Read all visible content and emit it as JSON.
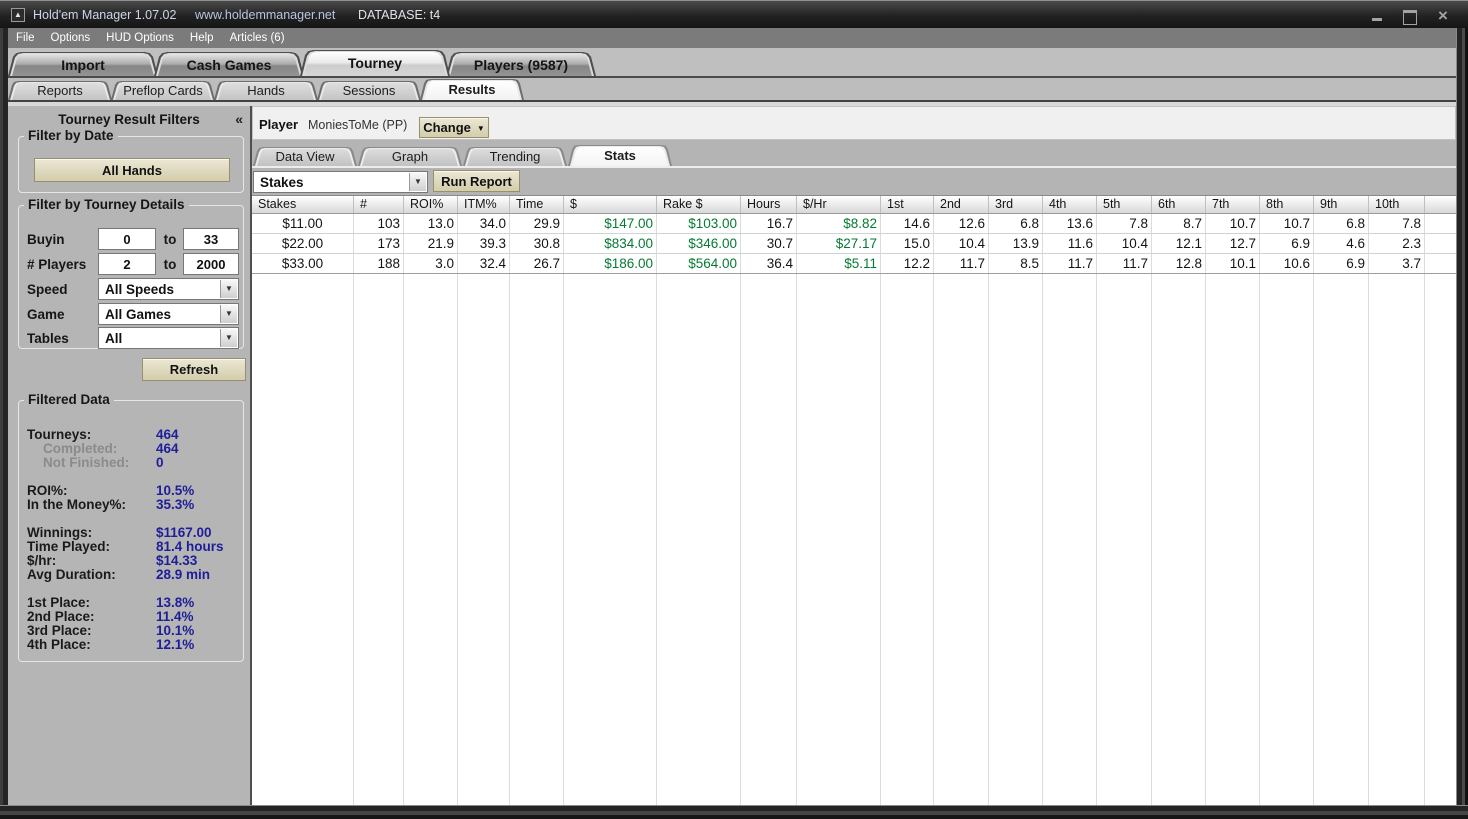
{
  "titlebar": {
    "title": "Hold'em Manager 1.07.02",
    "url": "www.holdemmanager.net",
    "database": "DATABASE: t4"
  },
  "menu": {
    "items": [
      "File",
      "Options",
      "HUD Options",
      "Help",
      "Articles (6)"
    ]
  },
  "main_tabs": {
    "items": [
      "Import",
      "Cash Games",
      "Tourney",
      "Players (9587)"
    ],
    "active": "Tourney"
  },
  "sub_tabs": {
    "items": [
      "Reports",
      "Preflop Cards",
      "Hands",
      "Sessions",
      "Results"
    ],
    "active": "Results"
  },
  "sidebar": {
    "title": "Tourney Result Filters",
    "collapse_icon": "«",
    "date_group": {
      "legend": "Filter by Date",
      "all_hands_button": "All Hands"
    },
    "details_group": {
      "legend": "Filter by Tourney Details",
      "buyin": {
        "label": "Buyin",
        "from": "0",
        "to_word": "to",
        "to": "33"
      },
      "players": {
        "label": "# Players",
        "from": "2",
        "to_word": "to",
        "to": "2000"
      },
      "speed": {
        "label": "Speed",
        "value": "All Speeds"
      },
      "game": {
        "label": "Game",
        "value": "All Games"
      },
      "tables": {
        "label": "Tables",
        "value": "All"
      }
    },
    "refresh_button": "Refresh",
    "filtered_group": {
      "legend": "Filtered Data",
      "stats": [
        {
          "label": "Tourneys:",
          "value": "464"
        },
        {
          "label": "Completed:",
          "value": "464",
          "muted": true,
          "indent": true
        },
        {
          "label": "Not Finished:",
          "value": "0",
          "muted": true,
          "indent": true
        },
        {
          "label": "ROI%:",
          "value": "10.5%",
          "gap": true
        },
        {
          "label": "In the Money%:",
          "value": "35.3%"
        },
        {
          "label": "Winnings:",
          "value": "$1167.00",
          "gap": true
        },
        {
          "label": "Time Played:",
          "value": "81.4 hours"
        },
        {
          "label": "$/hr:",
          "value": "$14.33"
        },
        {
          "label": "Avg Duration:",
          "value": "28.9 min"
        },
        {
          "label": "1st Place:",
          "value": "13.8%",
          "gap": true
        },
        {
          "label": "2nd Place:",
          "value": "11.4%"
        },
        {
          "label": "3rd Place:",
          "value": "10.1%"
        },
        {
          "label": "4th Place:",
          "value": "12.1%"
        }
      ]
    }
  },
  "player_bar": {
    "label": "Player",
    "name": "MoniesToMe (PP)",
    "change_button": "Change"
  },
  "view_tabs": {
    "items": [
      "Data View",
      "Graph",
      "Trending",
      "Stats"
    ],
    "active": "Stats"
  },
  "toolbar": {
    "report_type": "Stakes",
    "run_report_button": "Run Report"
  },
  "results_table": {
    "columns": [
      "Stakes",
      "#",
      "ROI%",
      "ITM%",
      "Time",
      "$",
      "Rake $",
      "Hours",
      "$/Hr",
      "1st",
      "2nd",
      "3rd",
      "4th",
      "5th",
      "6th",
      "7th",
      "8th",
      "9th",
      "10th",
      ""
    ],
    "money_columns": [
      5,
      6,
      8
    ],
    "rows": [
      [
        "$11.00",
        "103",
        "13.0",
        "34.0",
        "29.9",
        "$147.00",
        "$103.00",
        "16.7",
        "$8.82",
        "14.6",
        "12.6",
        "6.8",
        "13.6",
        "7.8",
        "8.7",
        "10.7",
        "10.7",
        "6.8",
        "7.8"
      ],
      [
        "$22.00",
        "173",
        "21.9",
        "39.3",
        "30.8",
        "$834.00",
        "$346.00",
        "30.7",
        "$27.17",
        "15.0",
        "10.4",
        "13.9",
        "11.6",
        "10.4",
        "12.1",
        "12.7",
        "6.9",
        "4.6",
        "2.3"
      ],
      [
        "$33.00",
        "188",
        "3.0",
        "32.4",
        "26.7",
        "$186.00",
        "$564.00",
        "36.4",
        "$5.11",
        "12.2",
        "11.7",
        "8.5",
        "11.7",
        "11.7",
        "12.8",
        "10.1",
        "10.6",
        "6.9",
        "3.7"
      ]
    ]
  },
  "colors": {
    "money_green": "#067a33",
    "value_blue": "#1e1e99",
    "button_beige": "#d3cdab"
  }
}
